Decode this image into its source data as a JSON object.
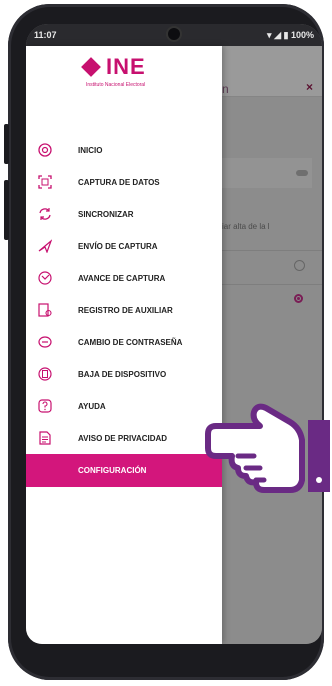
{
  "statusbar": {
    "time": "11:07",
    "battery": "100%"
  },
  "logo": {
    "text": "INE",
    "subtitle": "Instituto Nacional Electoral"
  },
  "background": {
    "title_fragment": "n",
    "close": "×",
    "text_fragment": "iar alta de la l"
  },
  "menu": {
    "items": [
      {
        "label": "INICIO",
        "icon": "home-circle-icon"
      },
      {
        "label": "CAPTURA DE DATOS",
        "icon": "scan-frame-icon"
      },
      {
        "label": "SINCRONIZAR",
        "icon": "sync-icon"
      },
      {
        "label": "ENVÍO DE CAPTURA",
        "icon": "send-icon"
      },
      {
        "label": "AVANCE DE CAPTURA",
        "icon": "progress-icon"
      },
      {
        "label": "REGISTRO DE AUXILIAR",
        "icon": "register-user-icon"
      },
      {
        "label": "CAMBIO DE CONTRASEÑA",
        "icon": "password-icon"
      },
      {
        "label": "BAJA DE DISPOSITIVO",
        "icon": "device-remove-icon"
      },
      {
        "label": "AYUDA",
        "icon": "help-icon"
      },
      {
        "label": "AVISO DE PRIVACIDAD",
        "icon": "privacy-doc-icon"
      },
      {
        "label": "CONFIGURACIÓN",
        "icon": "",
        "active": true
      }
    ]
  },
  "colors": {
    "accent": "#d3167c",
    "icon": "#c7106f",
    "hand": "#6a2a84"
  }
}
